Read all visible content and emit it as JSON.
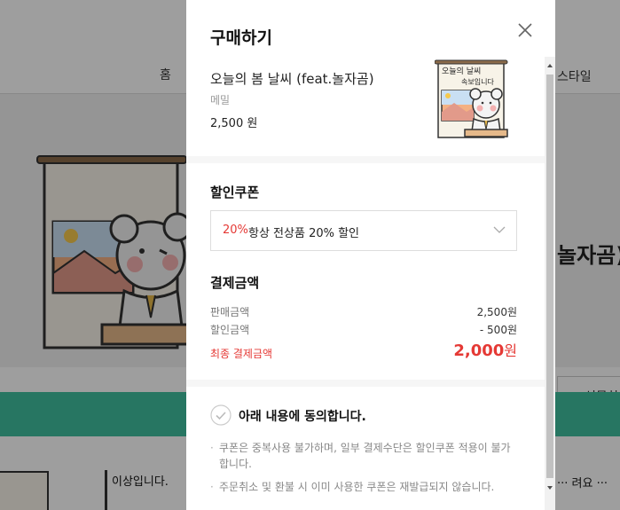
{
  "background": {
    "nav_home": "홈",
    "nav_style": "스타일",
    "title_fragment": "놀자곰)",
    "gift_button": "선물하",
    "sticker_caption": "이상입니다.",
    "sticker_caption2": "··· 려요 ···",
    "overlay_color": "#000000"
  },
  "modal": {
    "title": "구매하기",
    "close_icon": "close-icon",
    "product": {
      "name": "오늘의 봄 날씨 (feat.놀자곰)",
      "author": "메밀",
      "price": "2,500 원",
      "thumb_sign_line1": "오늘의 날씨",
      "thumb_sign_line2": "속보입니다"
    },
    "coupon": {
      "label": "할인쿠폰",
      "selected_percent": "20%",
      "selected_text": "항상 전상품 20% 할인",
      "chevron_icon": "chevron-down-icon"
    },
    "payment": {
      "label": "결제금액",
      "rows": [
        {
          "label": "판매금액",
          "value": "2,500원"
        },
        {
          "label": "할인금액",
          "value": "- 500원"
        }
      ],
      "final_label": "최종 결제금액",
      "final_value": "2,000",
      "final_unit": "원"
    },
    "agree": {
      "label": "아래 내용에 동의합니다.",
      "check_icon": "check-circle-icon",
      "notes": [
        "쿠폰은 중복사용 불가하며, 일부 결제수단은 할인쿠폰 적용이 불가합니다.",
        "주문취소 및 환불 시 이미 사용한 쿠폰은 재발급되지 않습니다."
      ]
    }
  },
  "colors": {
    "accent_red": "#e53935",
    "green_band": "#3fbf9e"
  }
}
